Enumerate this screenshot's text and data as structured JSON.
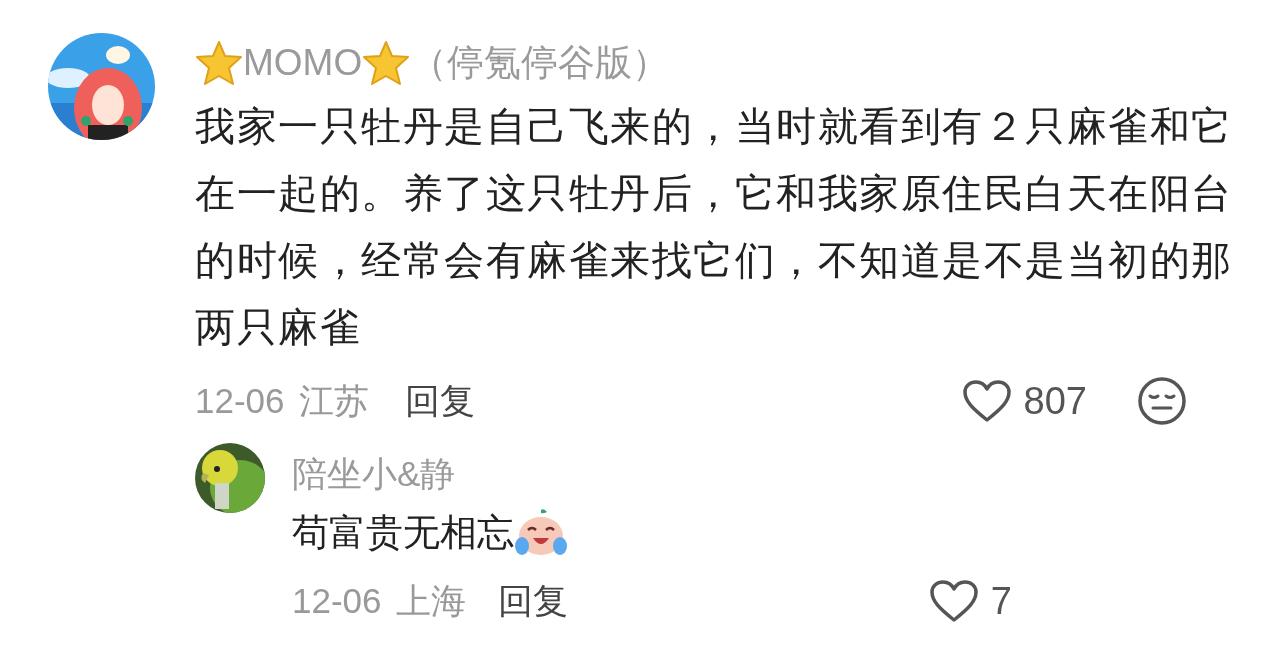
{
  "comment": {
    "name_parts": [
      {
        "kind": "star"
      },
      {
        "kind": "text",
        "text": "MOMO"
      },
      {
        "kind": "star"
      },
      {
        "kind": "text",
        "text": "（停氪停谷版）"
      }
    ],
    "body": "我家一只牡丹是自己飞来的，当时就看到有２只麻雀和它在一起的。养了这只牡丹后，它和我家原住民白天在阳台的时候，经常会有麻雀来找它们，不知道是不是当初的那两只麻雀",
    "date": "12-06",
    "location": "江苏",
    "reply_label": "回复",
    "likes": "807",
    "reply": {
      "name": "陪坐小&静",
      "body": "苟富贵无相忘",
      "emoji": true,
      "date": "12-06",
      "location": "上海",
      "reply_label": "回复",
      "likes": "7"
    }
  }
}
